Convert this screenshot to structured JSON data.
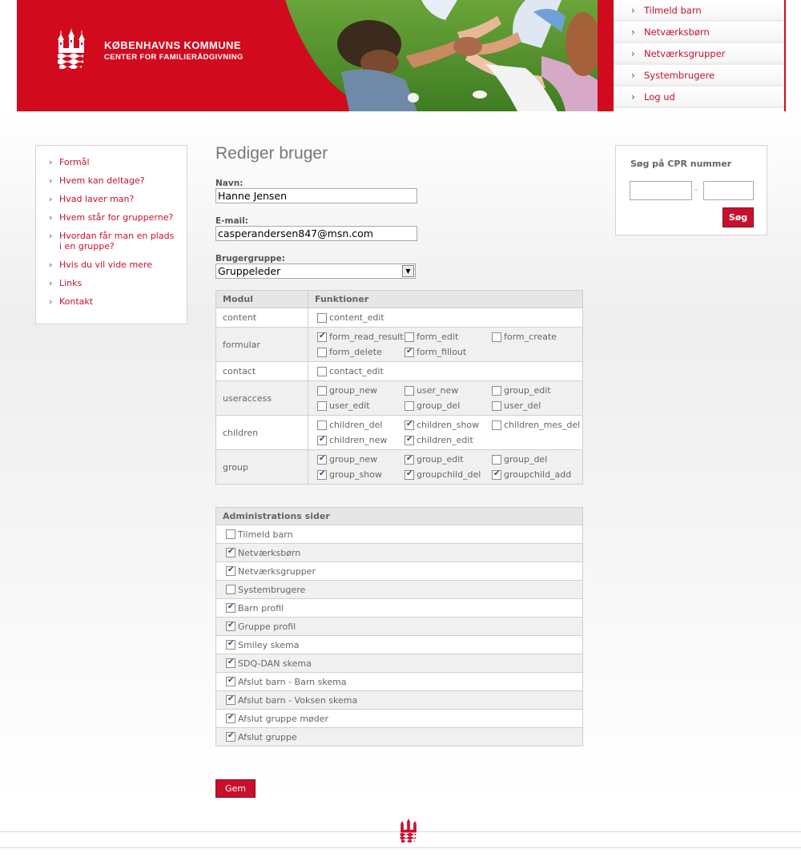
{
  "header": {
    "brand_title": "KØBENHAVNS KOMMUNE",
    "brand_subtitle": "CENTER FOR FAMILIERÅDGIVNING",
    "nav": [
      "Tilmeld barn",
      "Netværksbørn",
      "Netværksgrupper",
      "Systembrugere",
      "Log ud"
    ]
  },
  "sidebar": {
    "items": [
      "Formål",
      "Hvem kan deltage?",
      "Hvad laver man?",
      "Hvem står for grupperne?",
      "Hvordan får man en plads i en gruppe?",
      "Hvis du vil vide mere",
      "Links",
      "Kontakt"
    ]
  },
  "form": {
    "title": "Rediger bruger",
    "name_label": "Navn:",
    "name_value": "Hanne Jensen",
    "email_label": "E-mail:",
    "email_value": "casperandersen847@msn.com",
    "group_label": "Brugergruppe:",
    "group_value": "Gruppeleder",
    "save_label": "Gem"
  },
  "permissions": {
    "col_module": "Modul",
    "col_functions": "Funktioner",
    "rows": [
      {
        "module": "content",
        "functions": [
          {
            "name": "content_edit",
            "checked": false
          }
        ]
      },
      {
        "module": "formular",
        "functions": [
          {
            "name": "form_read_result",
            "checked": true
          },
          {
            "name": "form_edit",
            "checked": false
          },
          {
            "name": "form_create",
            "checked": false
          },
          {
            "name": "form_delete",
            "checked": false
          },
          {
            "name": "form_fillout",
            "checked": true
          }
        ]
      },
      {
        "module": "contact",
        "functions": [
          {
            "name": "contact_edit",
            "checked": false
          }
        ]
      },
      {
        "module": "useraccess",
        "functions": [
          {
            "name": "group_new",
            "checked": false
          },
          {
            "name": "user_new",
            "checked": false
          },
          {
            "name": "group_edit",
            "checked": false
          },
          {
            "name": "user_edit",
            "checked": false
          },
          {
            "name": "group_del",
            "checked": false
          },
          {
            "name": "user_del",
            "checked": false
          }
        ]
      },
      {
        "module": "children",
        "functions": [
          {
            "name": "children_del",
            "checked": false
          },
          {
            "name": "children_show",
            "checked": true
          },
          {
            "name": "children_mes_del",
            "checked": false
          },
          {
            "name": "children_new",
            "checked": true
          },
          {
            "name": "children_edit",
            "checked": true
          }
        ]
      },
      {
        "module": "group",
        "functions": [
          {
            "name": "group_new",
            "checked": true
          },
          {
            "name": "group_edit",
            "checked": true
          },
          {
            "name": "group_del",
            "checked": false
          },
          {
            "name": "group_show",
            "checked": true
          },
          {
            "name": "groupchild_del",
            "checked": true
          },
          {
            "name": "groupchild_add",
            "checked": true
          }
        ]
      }
    ]
  },
  "admin_pages": {
    "title": "Administrations sider",
    "items": [
      {
        "label": "Tilmeld barn",
        "checked": false
      },
      {
        "label": "Netværksbørn",
        "checked": true
      },
      {
        "label": "Netværksgrupper",
        "checked": true
      },
      {
        "label": "Systembrugere",
        "checked": false
      },
      {
        "label": "Barn profil",
        "checked": true
      },
      {
        "label": "Gruppe profil",
        "checked": true
      },
      {
        "label": "Smiley skema",
        "checked": true
      },
      {
        "label": "SDQ-DAN skema",
        "checked": true
      },
      {
        "label": "Afslut barn - Barn skema",
        "checked": true
      },
      {
        "label": "Afslut barn - Voksen skema",
        "checked": true
      },
      {
        "label": "Afslut gruppe møder",
        "checked": true
      },
      {
        "label": "Afslut gruppe",
        "checked": true
      }
    ]
  },
  "search": {
    "title": "Søg på CPR nummer",
    "separator": "-",
    "button_label": "Søg"
  },
  "colors": {
    "brand_red": "#d10a1e",
    "link_red": "#c8102e"
  }
}
